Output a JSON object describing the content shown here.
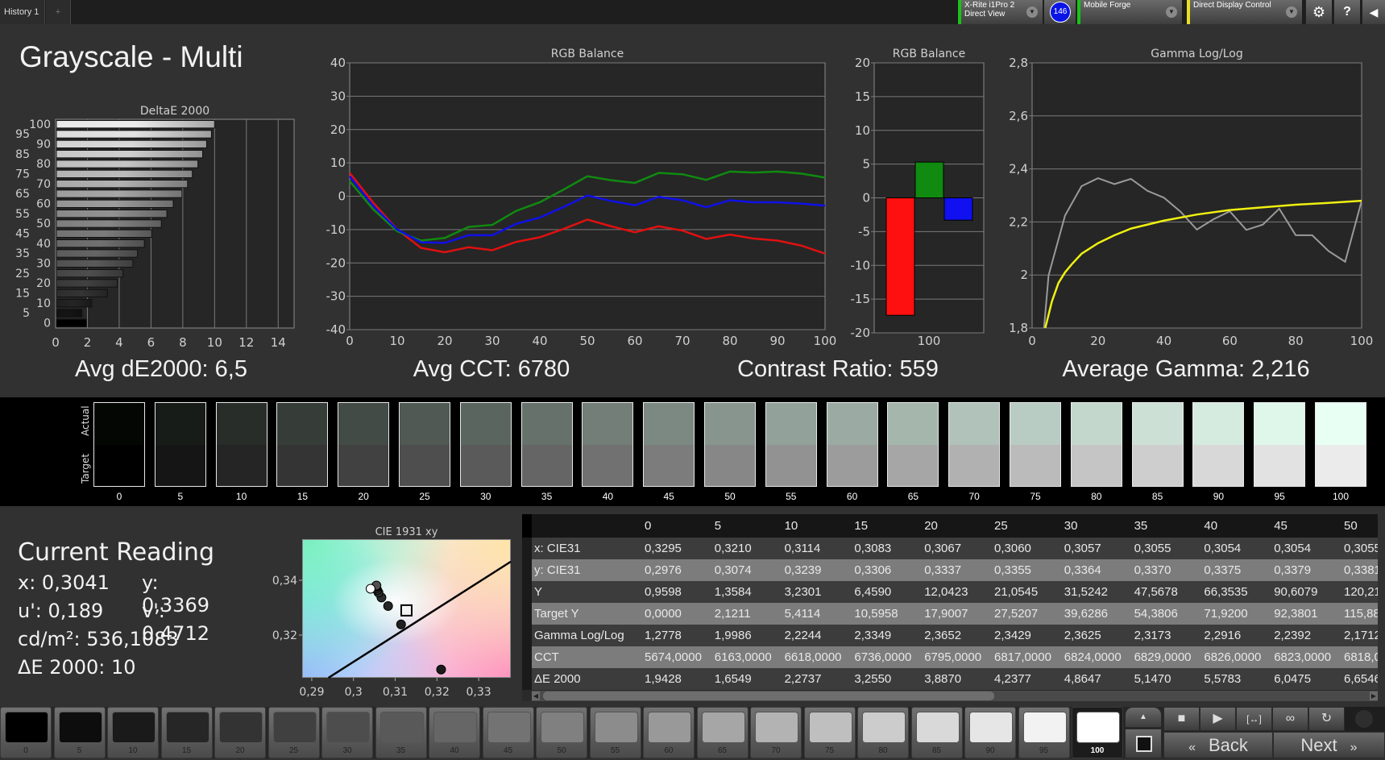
{
  "topbar": {
    "tab": "History 1",
    "add_tab": "+",
    "meter": {
      "line1": "X-Rite i1Pro 2",
      "line2": "Direct View"
    },
    "badge": "146",
    "display": "Mobile Forge",
    "pattern_generator": "Direct Display Control",
    "icons": [
      "gear-icon",
      "help-icon",
      "collapse-arrow-icon"
    ],
    "colors": {
      "meter": "#18c418",
      "display": "#18c418",
      "pattern": "#e8e020",
      "badge": "#0a14e6"
    }
  },
  "title": "Grayscale - Multi",
  "stats": {
    "avg_de": "Avg dE2000: 6,5",
    "avg_cct": "Avg CCT: 6780",
    "contrast": "Contrast Ratio: 559",
    "avg_gamma": "Average Gamma: 2,216"
  },
  "swatches": {
    "actual_label": "Actual",
    "target_label": "Target",
    "levels": [
      "0",
      "5",
      "10",
      "15",
      "20",
      "25",
      "30",
      "35",
      "40",
      "45",
      "50",
      "55",
      "60",
      "65",
      "70",
      "75",
      "80",
      "85",
      "90",
      "95",
      "100"
    ]
  },
  "reading": {
    "title": "Current Reading",
    "x": "x: 0,3041",
    "y": "y: 0,3369",
    "u": "u': 0,189",
    "v": "v': 0,4712",
    "luminance": "cd/m²: 536,1083",
    "de": "ΔE 2000: 10"
  },
  "table": {
    "columns": [
      "0",
      "5",
      "10",
      "15",
      "20",
      "25",
      "30",
      "35",
      "40",
      "45",
      "50"
    ],
    "rows": [
      {
        "label": "x: CIE31",
        "values": [
          "0,3295",
          "0,3210",
          "0,3114",
          "0,3083",
          "0,3067",
          "0,3060",
          "0,3057",
          "0,3055",
          "0,3054",
          "0,3054",
          "0,3055"
        ]
      },
      {
        "label": "y: CIE31",
        "values": [
          "0,2976",
          "0,3074",
          "0,3239",
          "0,3306",
          "0,3337",
          "0,3355",
          "0,3364",
          "0,3370",
          "0,3375",
          "0,3379",
          "0,3381"
        ]
      },
      {
        "label": "Y",
        "values": [
          "0,9598",
          "1,3584",
          "3,2301",
          "6,4590",
          "12,0423",
          "21,0545",
          "31,5242",
          "47,5678",
          "66,3535",
          "90,6079",
          "120,21"
        ]
      },
      {
        "label": "Target Y",
        "values": [
          "0,0000",
          "2,1211",
          "5,4114",
          "10,5958",
          "17,9007",
          "27,5207",
          "39,6286",
          "54,3806",
          "71,9200",
          "92,3801",
          "115,88"
        ]
      },
      {
        "label": "Gamma Log/Log",
        "values": [
          "1,2778",
          "1,9986",
          "2,2244",
          "2,3349",
          "2,3652",
          "2,3429",
          "2,3625",
          "2,3173",
          "2,2916",
          "2,2392",
          "2,1712"
        ]
      },
      {
        "label": "CCT",
        "values": [
          "5674,0000",
          "6163,0000",
          "6618,0000",
          "6736,0000",
          "6795,0000",
          "6817,0000",
          "6824,0000",
          "6829,0000",
          "6826,0000",
          "6823,0000",
          "6818,0"
        ]
      },
      {
        "label": "ΔE 2000",
        "values": [
          "1,9428",
          "1,6549",
          "2,2737",
          "3,2550",
          "3,8870",
          "4,2377",
          "4,8647",
          "5,1470",
          "5,5783",
          "6,0475",
          "6,6546"
        ]
      }
    ]
  },
  "bottom": {
    "levels": [
      "0",
      "5",
      "10",
      "15",
      "20",
      "25",
      "30",
      "35",
      "40",
      "45",
      "50",
      "55",
      "60",
      "65",
      "70",
      "75",
      "80",
      "85",
      "90",
      "95",
      "100"
    ],
    "selected": "100",
    "back": "Back",
    "next": "Next",
    "back_glyph": "«",
    "next_glyph": "»",
    "controls": [
      "stop-icon",
      "play-icon",
      "fit-icon",
      "loop-icon",
      "refresh-icon",
      "status-circle-icon"
    ]
  },
  "chart_data": [
    {
      "id": "deltae",
      "type": "bar",
      "orientation": "horizontal",
      "title": "DeltaE 2000",
      "categories": [
        "0",
        "5",
        "10",
        "15",
        "20",
        "25",
        "30",
        "35",
        "40",
        "45",
        "50",
        "55",
        "60",
        "65",
        "70",
        "75",
        "80",
        "85",
        "90",
        "95",
        "100"
      ],
      "values": [
        1.94,
        1.65,
        2.27,
        3.26,
        3.89,
        4.24,
        4.86,
        5.15,
        5.58,
        6.05,
        6.65,
        7.0,
        7.4,
        7.95,
        8.3,
        8.6,
        8.95,
        9.25,
        9.5,
        9.8,
        10.0
      ],
      "xlim": [
        0,
        15
      ],
      "xticks": [
        "0",
        "2",
        "4",
        "6",
        "8",
        "10",
        "12",
        "14"
      ],
      "grid": true
    },
    {
      "id": "rgb_line",
      "type": "line",
      "title": "RGB Balance",
      "x": [
        0,
        5,
        10,
        15,
        20,
        25,
        30,
        35,
        40,
        45,
        50,
        55,
        60,
        65,
        70,
        75,
        80,
        85,
        90,
        95,
        100
      ],
      "series": [
        {
          "color": "#e01010",
          "values": [
            7,
            -2,
            -10,
            -15.5,
            -16.8,
            -15.3,
            -16.2,
            -13.7,
            -12.3,
            -9.8,
            -7,
            -9,
            -10.8,
            -9,
            -10.3,
            -12.8,
            -11.5,
            -12.7,
            -13.3,
            -14.8,
            -17.2
          ]
        },
        {
          "color": "#108a10",
          "values": [
            4.5,
            -4,
            -10.5,
            -13.3,
            -12.5,
            -9.2,
            -8.6,
            -4.4,
            -1.8,
            2,
            6,
            4.8,
            4,
            7,
            6.6,
            4.9,
            7.4,
            7.1,
            7.4,
            6.8,
            5.6
          ]
        },
        {
          "color": "#1010e8",
          "values": [
            6,
            -3,
            -10,
            -13.8,
            -14,
            -11.7,
            -11.7,
            -8.3,
            -6.4,
            -3.2,
            0.2,
            -1.4,
            -2.7,
            -0.2,
            -1.2,
            -3.3,
            -1.2,
            -1.8,
            -1.8,
            -2.2,
            -2.8
          ]
        }
      ],
      "xlim": [
        0,
        100
      ],
      "ylim": [
        -40,
        40
      ],
      "xticks": [
        "0",
        "10",
        "20",
        "30",
        "40",
        "50",
        "60",
        "70",
        "80",
        "90",
        "100"
      ],
      "yticks": [
        "-40",
        "-30",
        "-20",
        "-10",
        "0",
        "10",
        "20",
        "30",
        "40"
      ],
      "grid": true
    },
    {
      "id": "rgb_bar",
      "type": "bar",
      "title": "RGB Balance",
      "categories": [
        "100"
      ],
      "series": [
        {
          "color": "#ff1010",
          "values": [
            -17.4
          ]
        },
        {
          "color": "#108a10",
          "values": [
            5.3
          ]
        },
        {
          "color": "#1010f0",
          "values": [
            -3.3
          ]
        }
      ],
      "ylim": [
        -20,
        20
      ],
      "yticks": [
        "-20",
        "-15",
        "-10",
        "-5",
        "0",
        "5",
        "10",
        "15",
        "20"
      ],
      "grid": true
    },
    {
      "id": "gamma",
      "type": "line",
      "title": "Gamma Log/Log",
      "series": [
        {
          "color": "#9a9a9a",
          "x": [
            0,
            5,
            10,
            15,
            20,
            25,
            30,
            35,
            40,
            45,
            50,
            55,
            60,
            65,
            70,
            75,
            80,
            85,
            90,
            95,
            100
          ],
          "values": [
            1.2778,
            1.9986,
            2.2244,
            2.3349,
            2.3652,
            2.3429,
            2.3625,
            2.3173,
            2.2916,
            2.2392,
            2.1712,
            2.21,
            2.24,
            2.17,
            2.19,
            2.25,
            2.15,
            2.15,
            2.09,
            2.05,
            2.28
          ]
        },
        {
          "color": "#f0f010",
          "x": [
            4,
            6,
            8,
            10,
            12,
            15,
            20,
            25,
            30,
            40,
            50,
            60,
            70,
            80,
            90,
            100
          ],
          "values": [
            1.8,
            1.9,
            1.97,
            2.01,
            2.04,
            2.08,
            2.12,
            2.15,
            2.175,
            2.205,
            2.228,
            2.245,
            2.255,
            2.265,
            2.272,
            2.28
          ]
        }
      ],
      "xlim": [
        0,
        100
      ],
      "ylim": [
        1.8,
        2.8
      ],
      "xticks": [
        "0",
        "20",
        "40",
        "60",
        "80",
        "100"
      ],
      "yticks": [
        "1,8",
        "2",
        "2,2",
        "2,4",
        "2,6",
        "2,8"
      ],
      "grid": true
    },
    {
      "id": "cie",
      "type": "scatter",
      "title": "CIE 1931 xy",
      "points": [
        {
          "x": 0.321,
          "y": 0.3074,
          "level": 5
        },
        {
          "x": 0.3114,
          "y": 0.3239,
          "level": 10
        },
        {
          "x": 0.3083,
          "y": 0.3306,
          "level": 15
        },
        {
          "x": 0.3067,
          "y": 0.3337,
          "level": 20
        },
        {
          "x": 0.306,
          "y": 0.3355,
          "level": 25
        },
        {
          "x": 0.3057,
          "y": 0.3364,
          "level": 30
        },
        {
          "x": 0.3055,
          "y": 0.337,
          "level": 35
        },
        {
          "x": 0.3054,
          "y": 0.3375,
          "level": 40
        },
        {
          "x": 0.3054,
          "y": 0.3379,
          "level": 45
        },
        {
          "x": 0.3055,
          "y": 0.3381,
          "level": 50
        },
        {
          "x": 0.3041,
          "y": 0.3369,
          "level": 100
        }
      ],
      "target": {
        "x": 0.3127,
        "y": 0.329
      },
      "locus": [
        [
          0.294,
          0.3044
        ],
        [
          0.3377,
          0.3468
        ]
      ],
      "xlim": [
        0.2877,
        0.3377
      ],
      "ylim": [
        0.3044,
        0.355
      ],
      "xticks": [
        {
          "v": 0.29,
          "label": "0,29"
        },
        {
          "v": 0.3,
          "label": "0,3"
        },
        {
          "v": 0.31,
          "label": "0,31"
        },
        {
          "v": 0.32,
          "label": "0,32"
        },
        {
          "v": 0.33,
          "label": "0,33"
        }
      ],
      "yticks": [
        {
          "v": 0.32,
          "label": "0,32"
        },
        {
          "v": 0.34,
          "label": "0,34"
        }
      ]
    }
  ]
}
